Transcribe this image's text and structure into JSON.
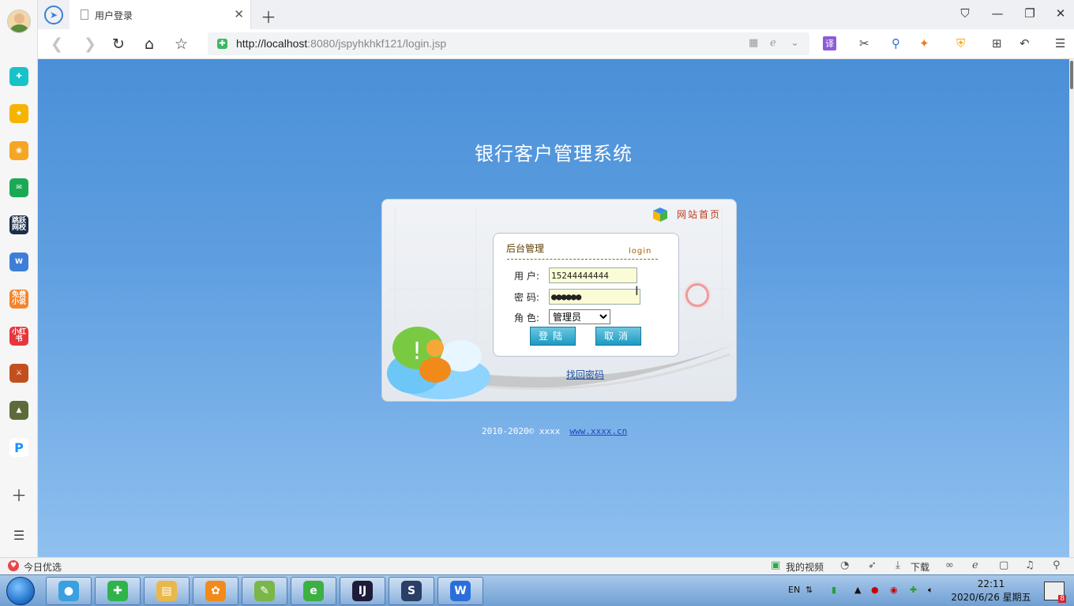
{
  "browser": {
    "tab_title": "用户登录",
    "url_host": "http://localhost",
    "url_rest": ":8080/jspyhkhkf121/login.jsp"
  },
  "sidebar": {
    "items": [
      {
        "name": "clipper-app-icon",
        "color": "#19c2c9",
        "glyph": "✚"
      },
      {
        "name": "favorites-icon",
        "color": "#f5b400",
        "glyph": "★"
      },
      {
        "name": "weibo-icon",
        "color": "#f5a623",
        "glyph": "◉"
      },
      {
        "name": "mail-icon",
        "color": "#1aaa55",
        "glyph": "✉"
      },
      {
        "name": "app-news-icon",
        "color": "#1c2f4a",
        "glyph": "跳跃\n网校"
      },
      {
        "name": "word-doc-icon",
        "color": "#3f7ed6",
        "glyph": "W"
      },
      {
        "name": "novel-app-icon",
        "color": "#f4842b",
        "glyph": "免费\n小说"
      },
      {
        "name": "xiaohongshu-icon",
        "color": "#e8353c",
        "glyph": "小红书"
      },
      {
        "name": "game-app-icon",
        "color": "#c2501e",
        "glyph": "⚔"
      },
      {
        "name": "game-app2-icon",
        "color": "#5d6b3a",
        "glyph": "▲"
      },
      {
        "name": "p-app-icon",
        "color": "#ffffff",
        "glyph": "P"
      }
    ]
  },
  "page": {
    "system_title": "银行客户管理系统",
    "home_link": "网站首页",
    "login": {
      "heading": "后台管理",
      "tag": "login",
      "user_label": "用  户:",
      "user_value": "15244444444",
      "password_label": "密  码:",
      "password_value": "●●●●●●",
      "role_label": "角  色:",
      "role_selected": "管理员",
      "login_button": "登陆",
      "cancel_button": "取消"
    },
    "recover_link": "找回密码",
    "footer_text": "2010-2020©  xxxx",
    "footer_link": "www.xxxx.cn"
  },
  "status_bar": {
    "today_pick": "今日优选",
    "my_video": "我的视频",
    "download": "下载"
  },
  "taskbar": {
    "apps": [
      {
        "name": "taskbar-app-colorballs",
        "color": "#3aa0e0",
        "glyph": "●"
      },
      {
        "name": "taskbar-app-360",
        "color": "#2fb34a",
        "glyph": "✚"
      },
      {
        "name": "taskbar-app-explorer",
        "color": "#e8b84b",
        "glyph": "▤"
      },
      {
        "name": "taskbar-app-orange",
        "color": "#f28a1a",
        "glyph": "✿"
      },
      {
        "name": "taskbar-app-notepad",
        "color": "#7ab648",
        "glyph": "✎"
      },
      {
        "name": "taskbar-app-ie-green",
        "color": "#3cb043",
        "glyph": "e"
      },
      {
        "name": "taskbar-app-intellij",
        "color": "#1d1d3a",
        "glyph": "IJ"
      },
      {
        "name": "taskbar-app-s",
        "color": "#2b3e66",
        "glyph": "S"
      },
      {
        "name": "taskbar-app-wps",
        "color": "#2a6fd9",
        "glyph": "W"
      }
    ],
    "lang": "EN",
    "time": "22:11",
    "date": "2020/6/26 星期五",
    "notif_count": "8"
  }
}
